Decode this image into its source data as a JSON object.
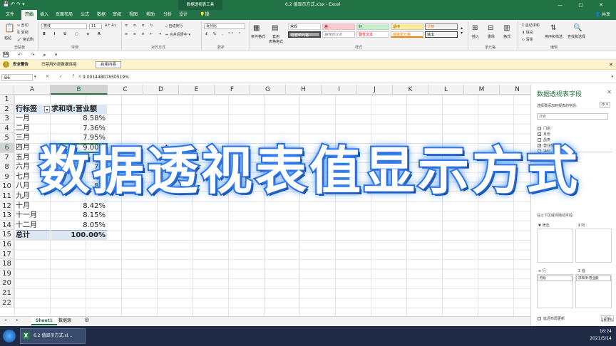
{
  "window": {
    "context_tab": "数据透视表工具",
    "title": "6.2 值显示方式.xlsx  -  Excel",
    "controls": "— ▢ ✕"
  },
  "tabs": {
    "items": [
      "文件",
      "开始",
      "插入",
      "页面布局",
      "公式",
      "数据",
      "审阅",
      "视图",
      "帮助",
      "分析",
      "设计"
    ],
    "tell_me": "操作说明搜索",
    "active": "开始"
  },
  "ribbon": {
    "clipboard": {
      "cut": "剪切",
      "copy": "复制",
      "format_painter": "格式刷",
      "paste": "粘贴",
      "label": "剪贴板"
    },
    "font": {
      "name": "等线",
      "size": "11",
      "label": "字体"
    },
    "alignment": {
      "wrap": "自动换行",
      "merge": "合并后居中",
      "label": "对齐方式"
    },
    "number": {
      "format": "百分比",
      "label": "数字"
    },
    "styles": {
      "conditional": "条件格式",
      "table": "套用\n表格格式",
      "cells": [
        "常规",
        "差",
        "好",
        "适中",
        "计算",
        "检查单元格",
        "解释性文本",
        "警告文本",
        "链接单元格",
        "输出"
      ],
      "label": "样式"
    },
    "cells": {
      "insert": "插入",
      "delete": "删除",
      "format": "格式",
      "label": "单元格"
    },
    "editing": {
      "autosum": "自动求和",
      "fill": "填充",
      "clear": "清除",
      "sort": "排序和筛选",
      "find": "查找和选择",
      "label": "编辑"
    }
  },
  "security": {
    "title": "安全警告",
    "message": "已禁用外部数据连接",
    "button": "启用内容"
  },
  "formula_bar": {
    "name_box": "B6",
    "fx": "✕ ✓ fx",
    "value": "9.00144807650519%"
  },
  "sheet": {
    "columns": [
      "A",
      "B",
      "C",
      "D",
      "E",
      "F",
      "G",
      "H",
      "I",
      "J",
      "K",
      "L",
      "M",
      "N"
    ],
    "rows": [
      "1",
      "2",
      "3",
      "4",
      "5",
      "6",
      "7",
      "8",
      "9",
      "10",
      "11",
      "12",
      "13",
      "14",
      "15",
      "16",
      "17",
      "18",
      "19",
      "20",
      "21",
      "22"
    ],
    "header_row_label": "行标签",
    "header_value_label": "求和项:营业额",
    "data": [
      {
        "label": "一月",
        "value": "8.58%"
      },
      {
        "label": "二月",
        "value": "7.36%"
      },
      {
        "label": "三月",
        "value": "7.95%"
      },
      {
        "label": "四月",
        "value": "9.00%"
      },
      {
        "label": "五月",
        "value": ""
      },
      {
        "label": "六月",
        "value": "7.9"
      },
      {
        "label": "七月",
        "value": "8."
      },
      {
        "label": "八月",
        "value": "8.1"
      },
      {
        "label": "九月",
        "value": ""
      },
      {
        "label": "十月",
        "value": "8.42%"
      },
      {
        "label": "十一月",
        "value": "8.15%"
      },
      {
        "label": "十二月",
        "value": "8.05%"
      }
    ],
    "total_label": "总计",
    "total_value": "100.00%"
  },
  "sheet_tabs": [
    "Sheet1",
    "数据源"
  ],
  "pivot_panel": {
    "title": "数据透视表字段",
    "choose_label": "选择要添加到报表的字段:",
    "search_placeholder": "搜索",
    "fields": [
      {
        "name": "门店",
        "checked": false
      },
      {
        "name": "月份",
        "checked": true
      },
      {
        "name": "品类",
        "checked": false
      },
      {
        "name": "营业额",
        "checked": true
      },
      {
        "name": "净利",
        "checked": false
      }
    ],
    "drag_label": "在以下区域间拖动字段:",
    "filters_label": "筛选",
    "columns_label": "列",
    "rows_label": "行",
    "values_label": "值",
    "rows_value": "月份",
    "values_value": "求和项:营业额",
    "defer_label": "延迟布局更新",
    "update_button": "更新"
  },
  "status": {
    "zoom": "160%"
  },
  "taskbar": {
    "app_label": "6.2 值显示方式.xl...",
    "time": "16:24",
    "date": "2021/5/14"
  },
  "overlay_title": "数据透视表值显示方式"
}
